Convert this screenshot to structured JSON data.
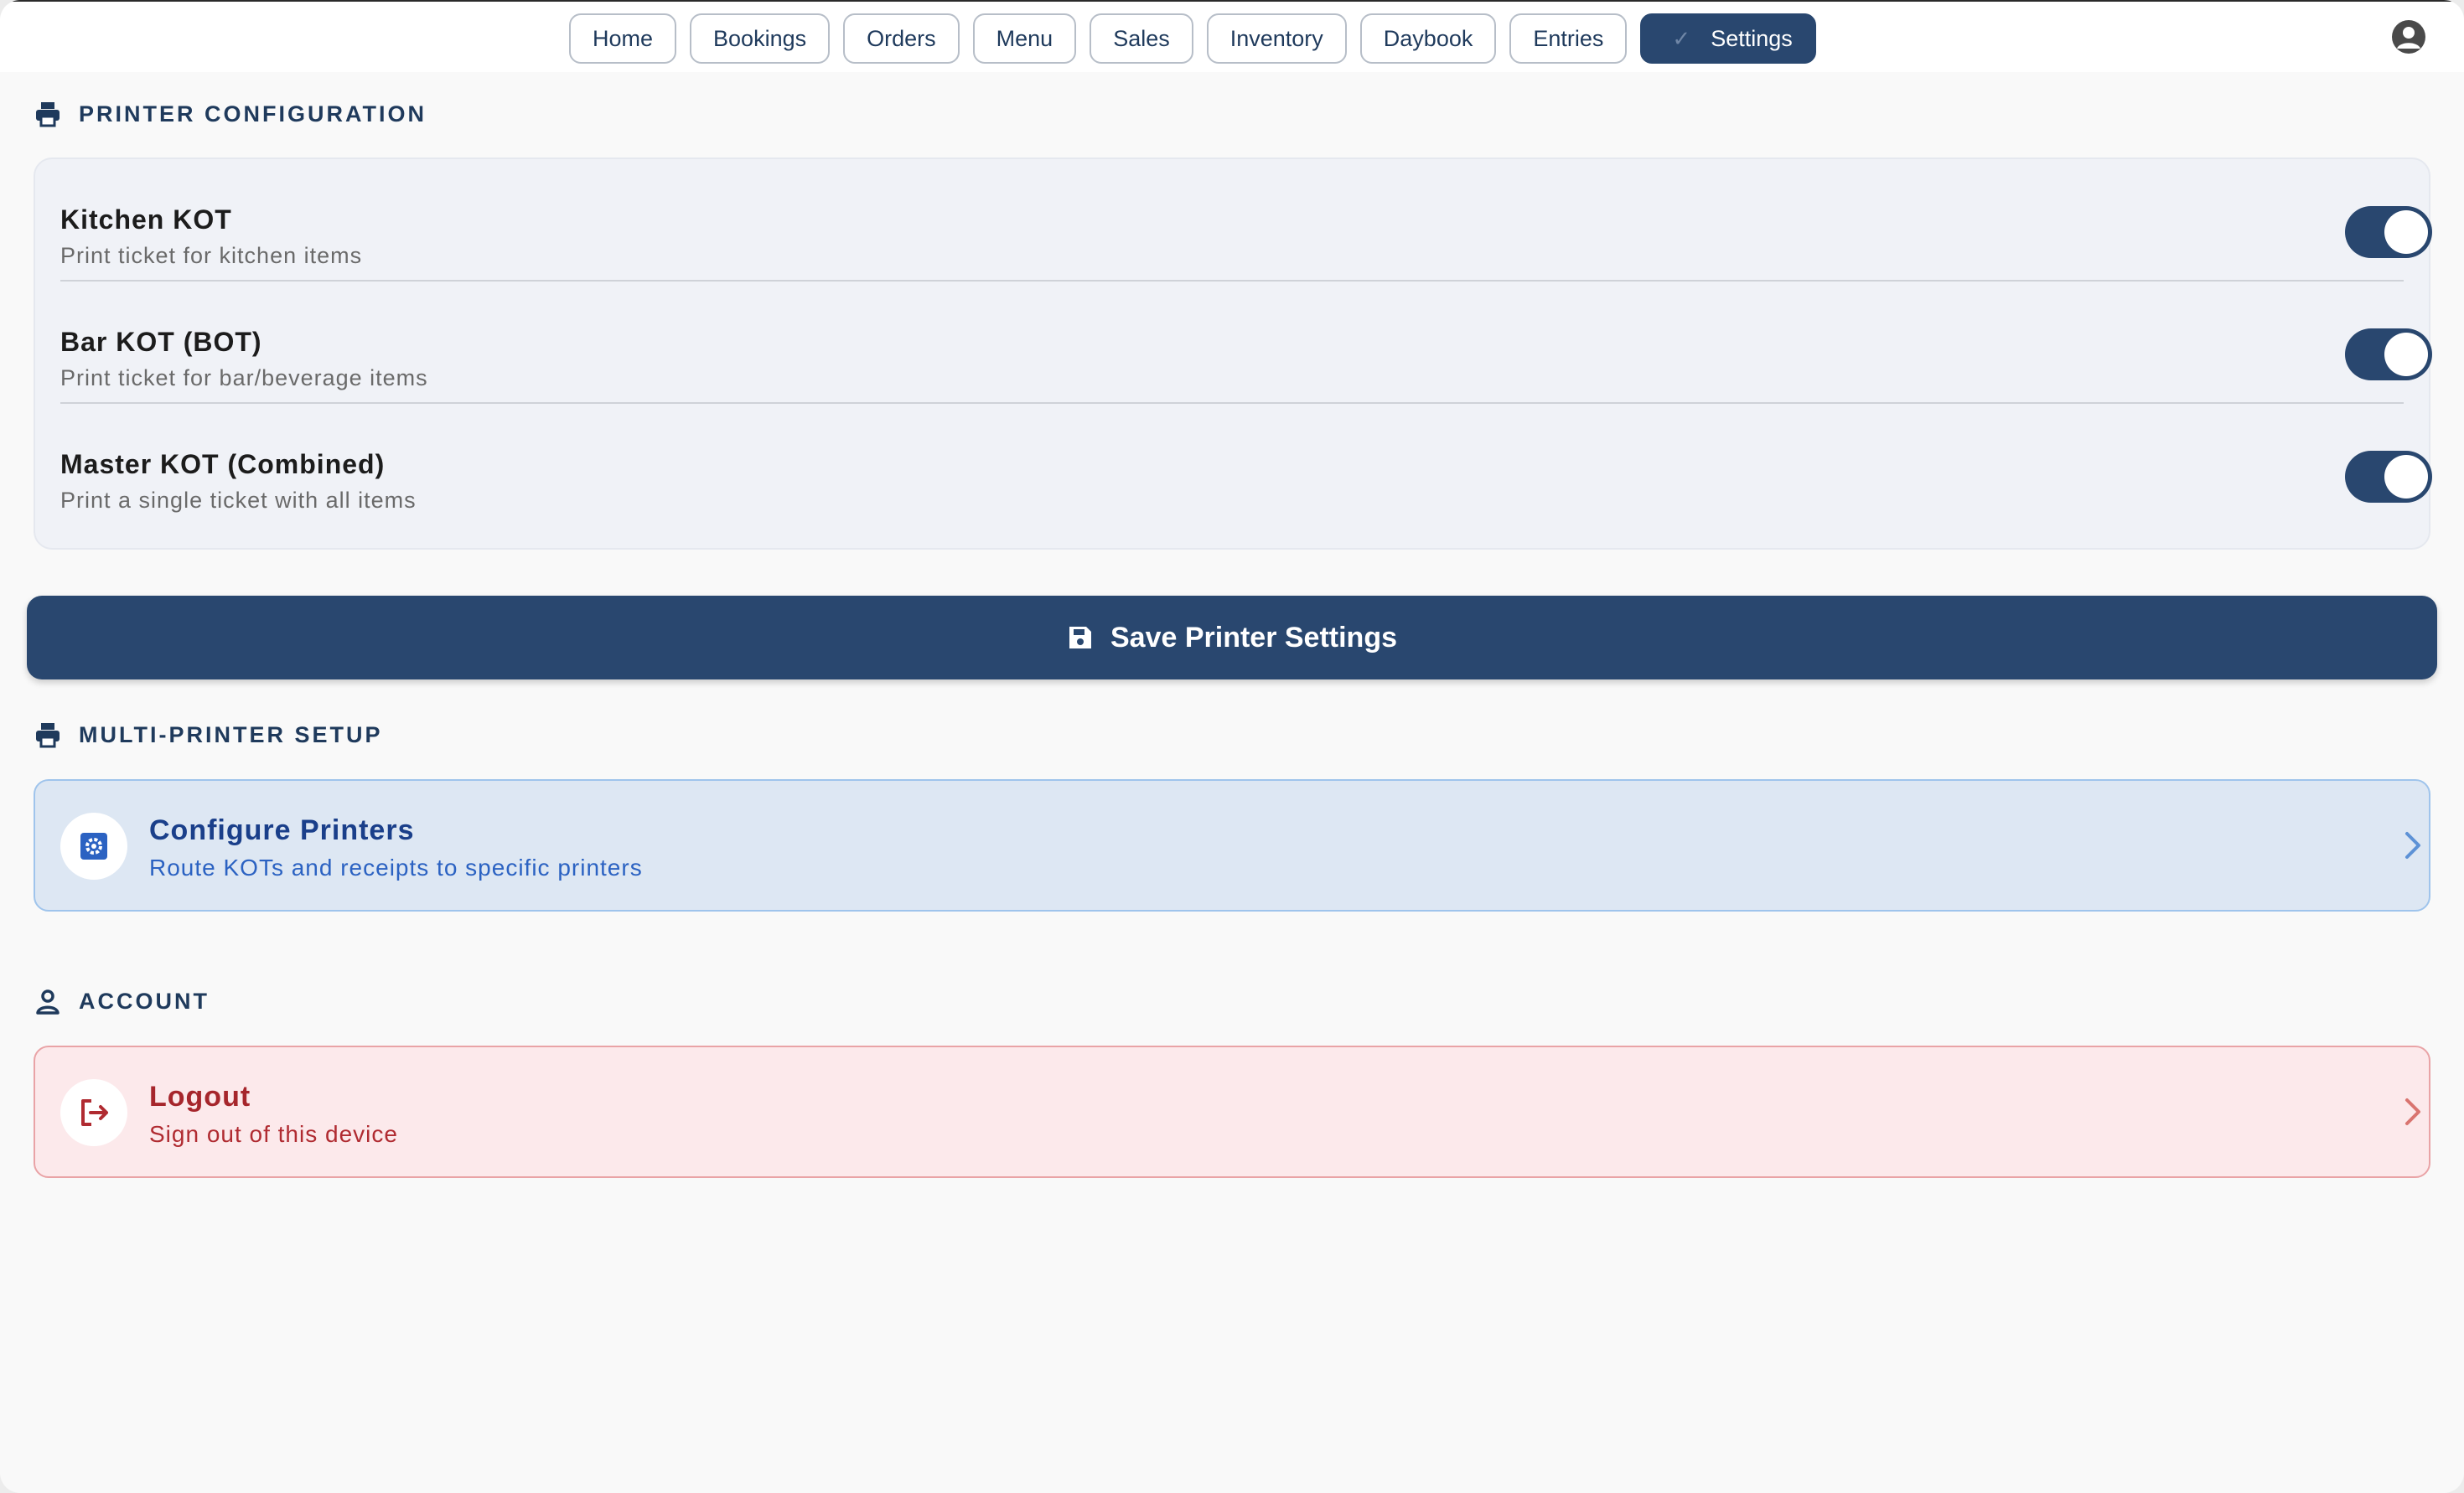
{
  "nav": {
    "tabs": [
      {
        "label": "Home"
      },
      {
        "label": "Bookings"
      },
      {
        "label": "Orders"
      },
      {
        "label": "Menu"
      },
      {
        "label": "Sales"
      },
      {
        "label": "Inventory"
      },
      {
        "label": "Daybook"
      },
      {
        "label": "Entries"
      },
      {
        "label": "Settings",
        "active": true
      }
    ],
    "account_icon": "user-circle-icon"
  },
  "printer_config": {
    "heading": "PRINTER CONFIGURATION",
    "icon": "printer-icon",
    "rows": [
      {
        "title": "Kitchen KOT",
        "subtitle": "Print ticket for kitchen items",
        "enabled": true
      },
      {
        "title": "Bar KOT (BOT)",
        "subtitle": "Print ticket for bar/beverage items",
        "enabled": true
      },
      {
        "title": "Master KOT (Combined)",
        "subtitle": "Print a single ticket with all items",
        "enabled": true
      }
    ],
    "save_label": "Save Printer Settings"
  },
  "multi_printer": {
    "heading": "MULTI-PRINTER SETUP",
    "icon": "printer-icon",
    "configure_title": "Configure Printers",
    "configure_subtitle": "Route KOTs and receipts to specific printers"
  },
  "account": {
    "heading": "ACCOUNT",
    "icon": "user-icon",
    "logout_title": "Logout",
    "logout_subtitle": "Sign out of this device"
  },
  "colors": {
    "primary": "#29476f",
    "info_bg": "#dde7f3",
    "danger_bg": "#fce9eb",
    "danger_text": "#a6262c"
  }
}
